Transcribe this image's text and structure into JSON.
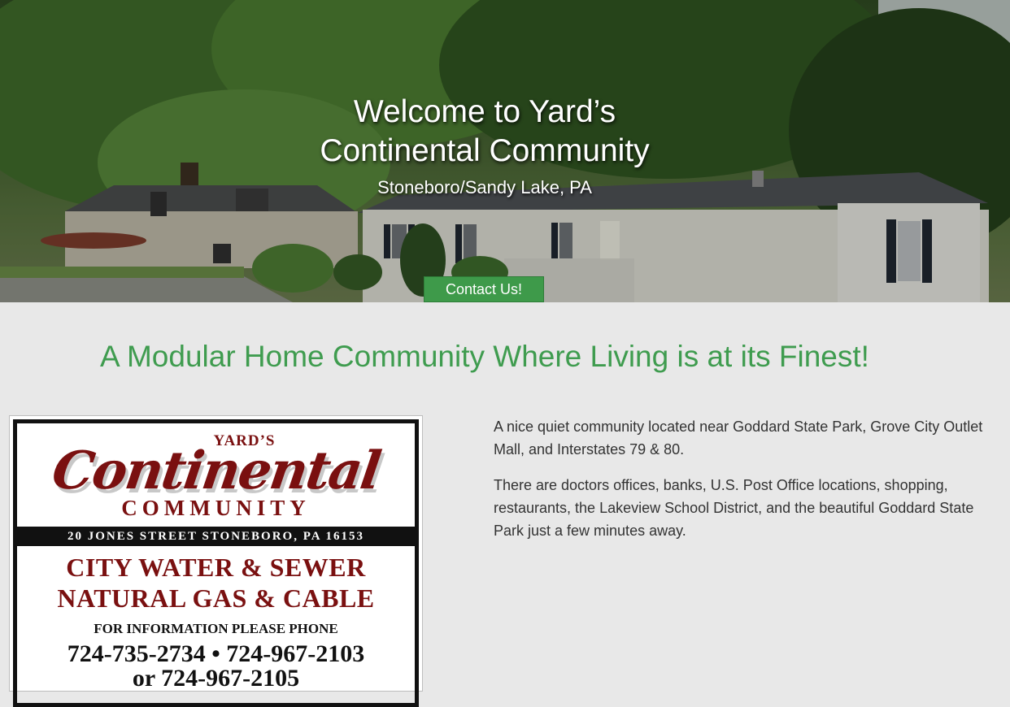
{
  "hero": {
    "title_line1": "Welcome to Yard’s",
    "title_line2": "Continental Community",
    "subtitle": "Stoneboro/Sandy Lake, PA",
    "contact_label": "Contact Us!"
  },
  "main": {
    "tagline": "A Modular Home Community Where Living is at its Finest!",
    "paragraphs": [
      "A nice quiet community located near Goddard State Park, Grove City Outlet Mall, and Interstates 79 & 80.",
      "There are doctors offices, banks, U.S. Post Office locations, shopping, restaurants, the Lakeview School District, and the beautiful Goddard State Park just a few minutes away."
    ]
  },
  "ad": {
    "yards": "YARD’S",
    "continental": "Continental",
    "community": "COMMUNITY",
    "address": "20 JONES STREET   STONEBORO, PA 16153",
    "line1": "CITY WATER & SEWER",
    "line2": "NATURAL GAS & CABLE",
    "info": "FOR INFORMATION PLEASE PHONE",
    "phones": "724-735-2734 • 724-967-2103",
    "phone3": "or 724-967-2105"
  },
  "colors": {
    "accent_green": "#3f9c4f",
    "button_green": "#3e9a4a",
    "ad_maroon": "#7a1010",
    "page_bg": "#e8e8e8"
  }
}
